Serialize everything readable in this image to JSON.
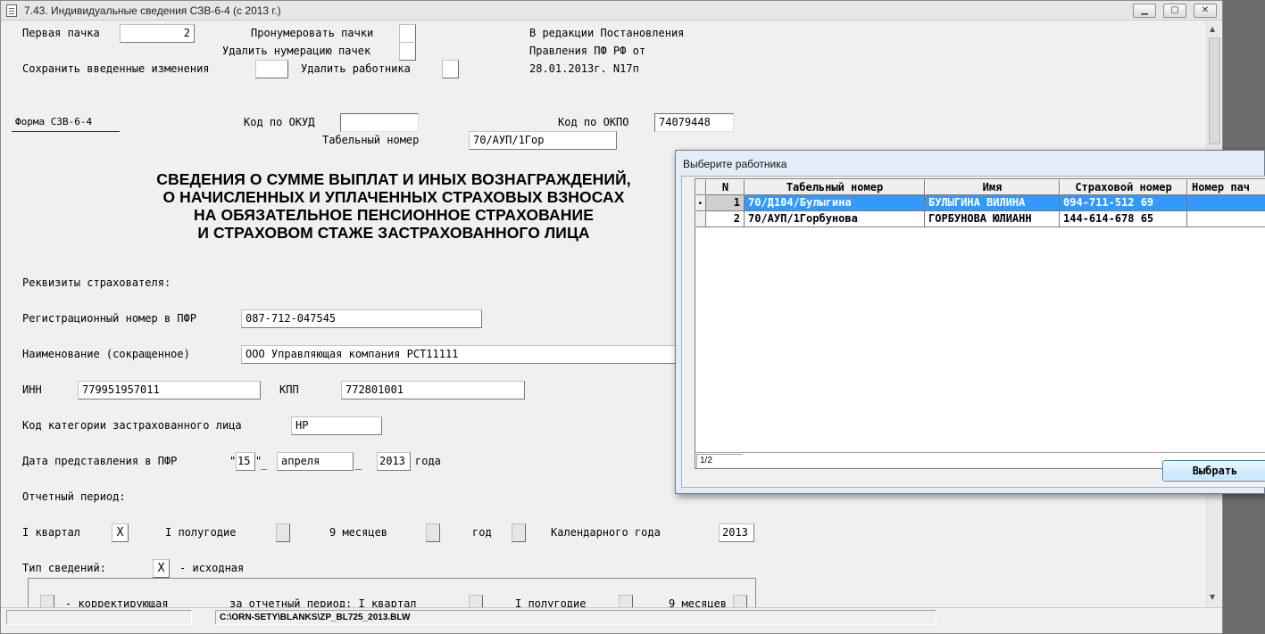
{
  "window": {
    "title": "7.43. Индивидуальные сведения СЗВ-6-4 (с 2013 г.)",
    "min": "▁",
    "max": "▢",
    "close": "✕"
  },
  "top": {
    "first_pack_label": "Первая пачка",
    "first_pack_value": "2",
    "number_packs_label": "Пронумеровать пачки",
    "remove_numbering_label": "Удалить нумерацию пачек",
    "save_changes_label": "Сохранить введенные изменения",
    "delete_employee_label": "Удалить работника",
    "edition_line1": "В редакции Постановления",
    "edition_line2": "Правления ПФ РФ от",
    "edition_line3": "28.01.2013г. N17п"
  },
  "form": {
    "form_name": "Форма СЗВ-6-4",
    "okud_label": "Код по ОКУД",
    "okud_value": "",
    "okpo_label": "Код по ОКПО",
    "okpo_value": "74079448",
    "tab_label": "Табельный номер",
    "tab_value": "70/АУП/1Гор"
  },
  "heading": [
    "СВЕДЕНИЯ О СУММЕ ВЫПЛАТ И ИНЫХ ВОЗНАГРАЖДЕНИЙ,",
    "О НАЧИСЛЕННЫХ И УПЛАЧЕННЫХ СТРАХОВЫХ ВЗНОСАХ",
    "НА ОБЯЗАТЕЛЬНОЕ ПЕНСИОННОЕ СТРАХОВАНИЕ",
    "И СТРАХОВОМ СТАЖЕ ЗАСТРАХОВАННОГО ЛИЦА"
  ],
  "insurer": {
    "section_label": "Реквизиты страхователя:",
    "reg_label": "Регистрационный номер в ПФР",
    "reg_value": "087-712-047545",
    "name_label": "Наименование (сокращенное)",
    "name_value": "ООО Управляющая компания РСТ11111",
    "inn_label": "ИНН",
    "inn_value": "779951957011",
    "kpp_label": "КПП",
    "kpp_value": "772801001",
    "category_label": "Код категории застрахованного лица",
    "category_value": "НР",
    "date_label": "Дата представления в ПФР",
    "date_day": "15",
    "date_month": "апреля",
    "date_year": "2013",
    "date_year_suffix": "года",
    "quote_open": "\"",
    "quote_close": "\"",
    "underscore": "_"
  },
  "period": {
    "label": "Отчетный период:",
    "q1_label": "I квартал",
    "q1_value": "X",
    "h1_label": "I полугодие",
    "m9_label": "9 месяцев",
    "year_label": "год",
    "cal_year_label": "Календарного года",
    "cal_year_value": "2013"
  },
  "info_type": {
    "label": "Тип сведений:",
    "value": "X",
    "initial_label": "- исходная",
    "corrective_label": "- корректирующая",
    "for_period_label": "за отчетный период: I квартал",
    "h1_label": "I полугодие",
    "m9_label": "9 месяцев"
  },
  "status": {
    "path": "C:\\ORN-SETY\\BLANKS\\ZP_BL725_2013.BLW"
  },
  "dialog": {
    "title": "Выберите работника",
    "columns": [
      "N",
      "Табельный номер",
      "Имя",
      "Страховой номер",
      "Номер пач"
    ],
    "rows": [
      {
        "n": "1",
        "tab": "70/Д104/Булыгина",
        "name": "БУЛЫГИНА ВИЛИНА",
        "snils": "094-711-512 69",
        "pack": ""
      },
      {
        "n": "2",
        "tab": "70/АУП/1Горбунова",
        "name": "ГОРБУНОВА ЮЛИАНН",
        "snils": "144-614-678 65",
        "pack": ""
      }
    ],
    "row_marker": "▸",
    "record_counter": "1/2",
    "select_button": "Выбрать"
  },
  "colors": {
    "selection": "#3399ff",
    "window_bg": "#f0f0f0",
    "desktop": "#6d6d6d"
  }
}
